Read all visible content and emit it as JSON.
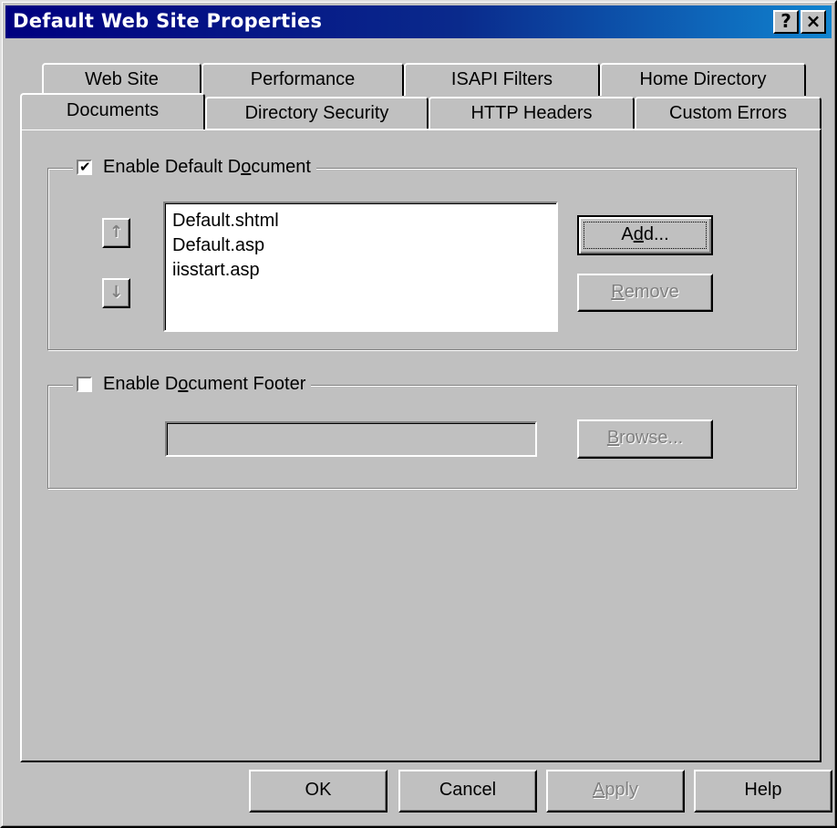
{
  "window": {
    "title": "Default Web Site Properties"
  },
  "title_buttons": {
    "help": "?",
    "close": "×"
  },
  "tabs": {
    "back_row": [
      "Web Site",
      "Performance",
      "ISAPI Filters",
      "Home Directory"
    ],
    "front_row": [
      "Documents",
      "Directory Security",
      "HTTP Headers",
      "Custom Errors"
    ],
    "selected": "Documents"
  },
  "default_document": {
    "label_before": "Enable Default D",
    "label_mnemonic": "o",
    "label_after": "cument",
    "checked": true,
    "check_glyph": "✔",
    "documents": [
      "Default.shtml",
      "Default.asp",
      "iisstart.asp"
    ],
    "move_up_glyph": "↑",
    "move_down_glyph": "↓",
    "add_before": "A",
    "add_mnemonic": "d",
    "add_after": "d...",
    "remove_mnemonic": "R",
    "remove_after": "emove"
  },
  "document_footer": {
    "label_before": "Enable D",
    "label_mnemonic": "o",
    "label_after": "cument Footer",
    "checked": false,
    "path_value": "",
    "browse_mnemonic": "B",
    "browse_after": "rowse..."
  },
  "footer_buttons": {
    "ok": "OK",
    "cancel": "Cancel",
    "apply_mnemonic": "A",
    "apply_after": "pply",
    "help": "Help"
  },
  "colors": {
    "title_gradient_start": "#000080",
    "title_gradient_end": "#1084d0",
    "face": "#c0c0c0",
    "disabled_text": "#808080"
  }
}
